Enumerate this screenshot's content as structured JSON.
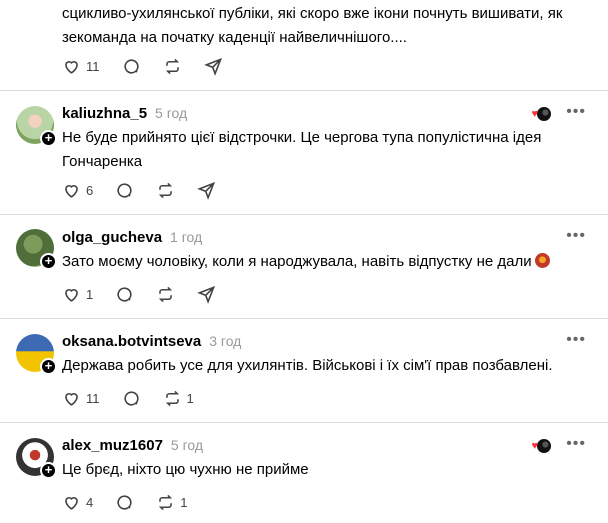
{
  "top_post": {
    "text": "сцикливо-ухилянської публіки, які скоро вже ікони почнуть вишивати, як зекоманда на початку каденції найвеличнішого....",
    "likes": "11"
  },
  "comments": [
    {
      "username": "kaliuzhna_5",
      "time": "5 год",
      "text": "Не буде прийнято цієї відстрочки. Це чергова тупа популістична ідея Гончаренка",
      "likes": "6",
      "comments": "",
      "reposts": "",
      "liked_by_author": true
    },
    {
      "username": "olga_gucheva",
      "time": "1 год",
      "text": "Зато моєму чоловіку, коли я народжувала, навіть відпустку не дали",
      "likes": "1",
      "comments": "",
      "reposts": "",
      "has_emoji": true
    },
    {
      "username": "oksana.botvintseva",
      "time": "3 год",
      "text": "Держава робить усе для ухилянтів. Військові і їх сім'ї прав позбавлені.",
      "likes": "11",
      "comments": "",
      "reposts": "1"
    },
    {
      "username": "alex_muz1607",
      "time": "5 год",
      "text": "Це брєд, ніхто цю чухню не прийме",
      "likes": "4",
      "comments": "",
      "reposts": "1",
      "liked_by_author": true
    }
  ],
  "icons": {
    "like": "heart-icon",
    "comment": "comment-icon",
    "repost": "repost-icon",
    "share": "share-icon",
    "more": "more-icon"
  },
  "colors": {
    "like_red": "#ff3040",
    "meta_gray": "#999999",
    "divider": "#dbdbdb"
  }
}
